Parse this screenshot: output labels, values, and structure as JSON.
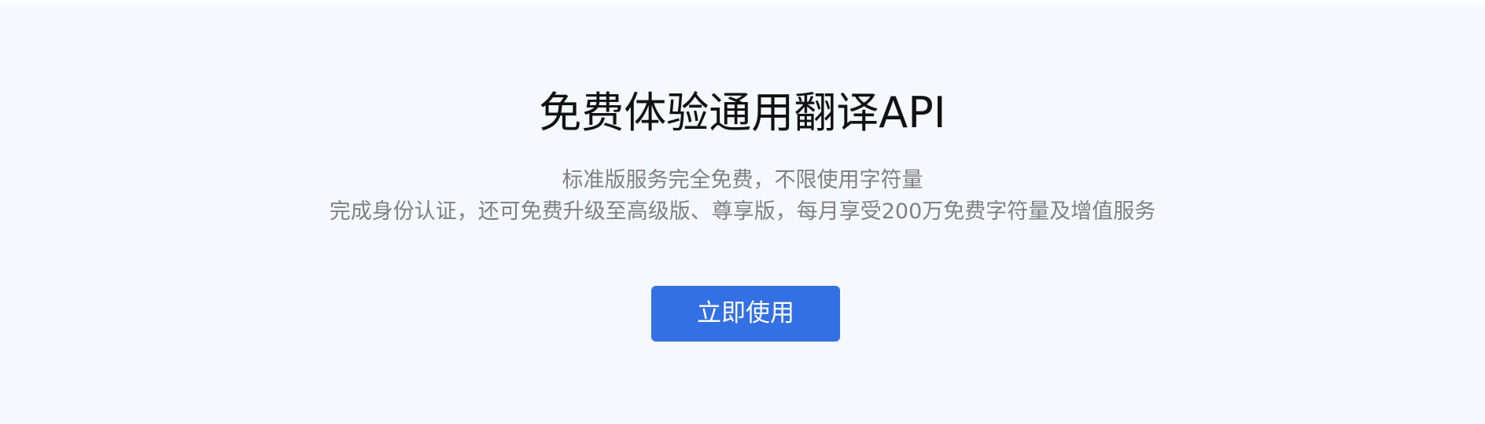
{
  "hero": {
    "title": "免费体验通用翻译API",
    "description_line1": "标准版服务完全免费，不限使用字符量",
    "description_line2": "完成身份认证，还可免费升级至高级版、尊享版，每月享受200万免费字符量及增值服务",
    "cta_label": "立即使用"
  },
  "colors": {
    "background": "#f5f8fc",
    "title": "#111111",
    "description": "#808080",
    "button": "#3370e3",
    "button_text": "#ffffff"
  }
}
